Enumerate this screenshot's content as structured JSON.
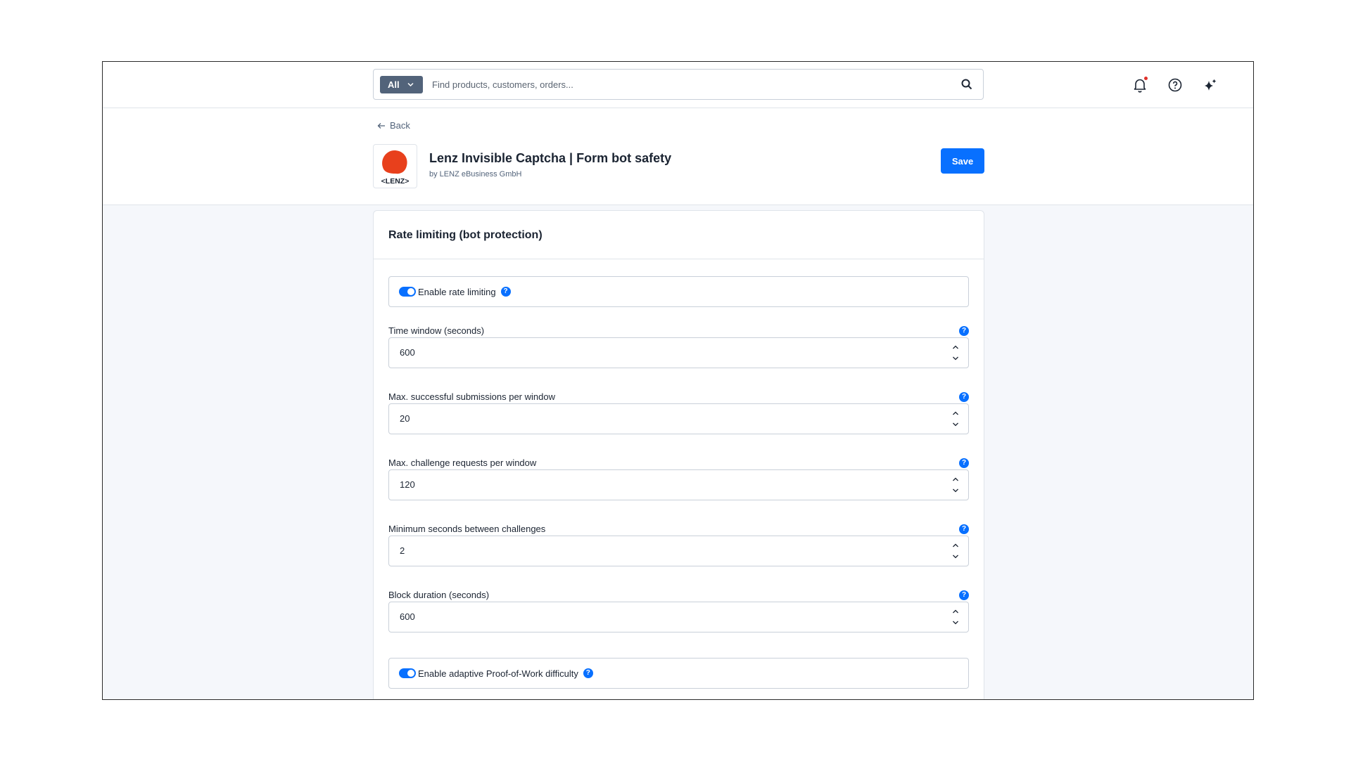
{
  "search": {
    "scope": "All",
    "placeholder": "Find products, customers, orders..."
  },
  "topbar": {
    "icons": [
      "bell-icon",
      "help-circle-icon",
      "sparkle-icon"
    ]
  },
  "header": {
    "back_label": "Back",
    "app_title": "Lenz Invisible Captcha | Form bot safety",
    "app_vendor": "by LENZ eBusiness GmbH",
    "logo_text": "<LENZ>",
    "save_label": "Save"
  },
  "card": {
    "title": "Rate limiting (bot protection)",
    "toggles": [
      {
        "label": "Enable rate limiting",
        "enabled": true
      },
      {
        "label": "Enable adaptive Proof-of-Work difficulty",
        "enabled": true
      }
    ],
    "fields": [
      {
        "label": "Time window (seconds)",
        "value": "600"
      },
      {
        "label": "Max. successful submissions per window",
        "value": "20"
      },
      {
        "label": "Max. challenge requests per window",
        "value": "120"
      },
      {
        "label": "Minimum seconds between challenges",
        "value": "2"
      },
      {
        "label": "Block duration (seconds)",
        "value": "600"
      }
    ]
  },
  "colors": {
    "primary": "#0870ff",
    "scope_bg": "#52637a",
    "logo_red": "#e8401c"
  }
}
